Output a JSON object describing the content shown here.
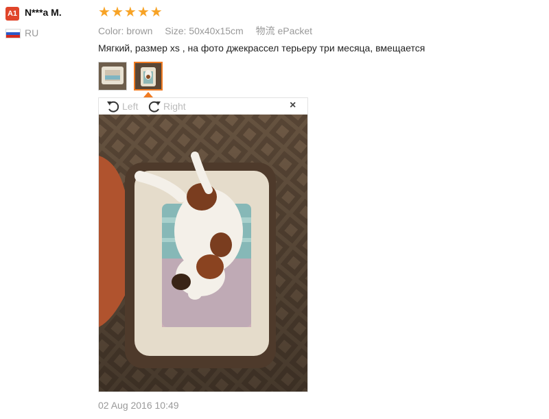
{
  "reviewer": {
    "badge": "A1",
    "name": "N***a M.",
    "country": "RU",
    "flag_colors": [
      "#ffffff",
      "#2a58c8",
      "#d52b1e"
    ]
  },
  "review": {
    "rating": 5,
    "star_color": "#f7a326",
    "attributes": [
      {
        "key": "Color:",
        "value": "brown"
      },
      {
        "key": "Size:",
        "value": "50x40x15cm"
      },
      {
        "key": "物流",
        "value": "ePacket"
      }
    ],
    "text": "Мягкий, размер xs , на фото джекрассел терьеру три месяца, вмещается",
    "date": "02 Aug 2016 10:49"
  },
  "thumbnails": [
    {
      "name": "photo-thumbnail-1",
      "selected": false
    },
    {
      "name": "photo-thumbnail-2",
      "selected": true
    }
  ],
  "viewer": {
    "rotate_left_label": "Left",
    "rotate_right_label": "Right",
    "close_label": "×"
  }
}
